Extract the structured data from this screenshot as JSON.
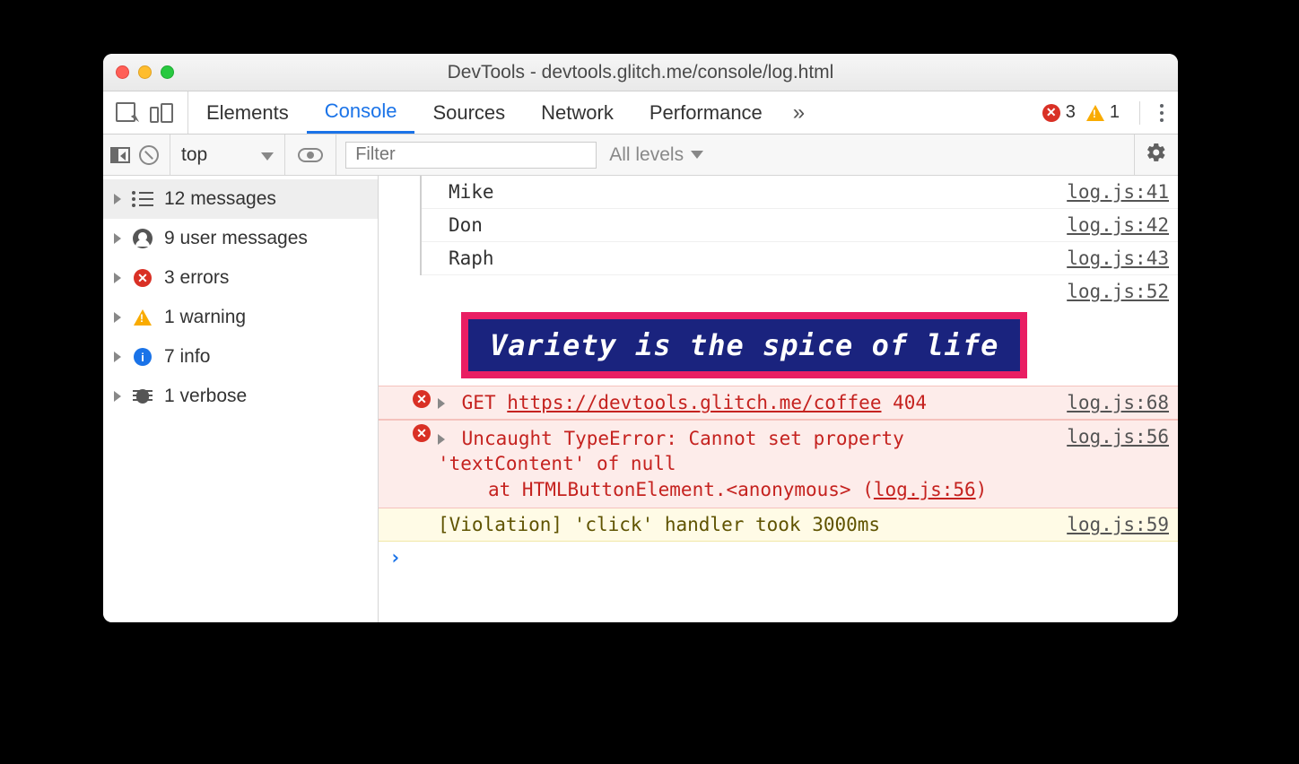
{
  "window": {
    "title": "DevTools - devtools.glitch.me/console/log.html"
  },
  "tabs": {
    "items": [
      "Elements",
      "Console",
      "Sources",
      "Network",
      "Performance"
    ],
    "active_index": 1,
    "more_glyph": "»"
  },
  "status": {
    "errors": "3",
    "warnings": "1"
  },
  "filter": {
    "context": "top",
    "placeholder": "Filter",
    "levels_label": "All levels"
  },
  "sidebar": {
    "items": [
      {
        "icon": "list",
        "label": "12 messages",
        "selected": true
      },
      {
        "icon": "user",
        "label": "9 user messages"
      },
      {
        "icon": "error",
        "label": "3 errors"
      },
      {
        "icon": "warning",
        "label": "1 warning"
      },
      {
        "icon": "info",
        "label": "7 info"
      },
      {
        "icon": "bug",
        "label": "1 verbose"
      }
    ]
  },
  "console": {
    "lines": [
      {
        "kind": "log",
        "text": "Mike",
        "src": "log.js:41"
      },
      {
        "kind": "log",
        "text": "Don",
        "src": "log.js:42"
      },
      {
        "kind": "log",
        "text": "Raph",
        "src": "log.js:43"
      }
    ],
    "banner": {
      "src": "log.js:52",
      "text": "Variety is the spice of life"
    },
    "net_error": {
      "method": "GET",
      "url": "https://devtools.glitch.me/coffee",
      "status": "404",
      "src": "log.js:68"
    },
    "exception": {
      "message": "Uncaught TypeError: Cannot set property 'textContent' of null",
      "stack_prefix": "at HTMLButtonElement.<anonymous> (",
      "stack_link": "log.js:56",
      "stack_suffix": ")",
      "src": "log.js:56"
    },
    "violation": {
      "text": "[Violation] 'click' handler took 3000ms",
      "src": "log.js:59"
    },
    "prompt": "›"
  }
}
